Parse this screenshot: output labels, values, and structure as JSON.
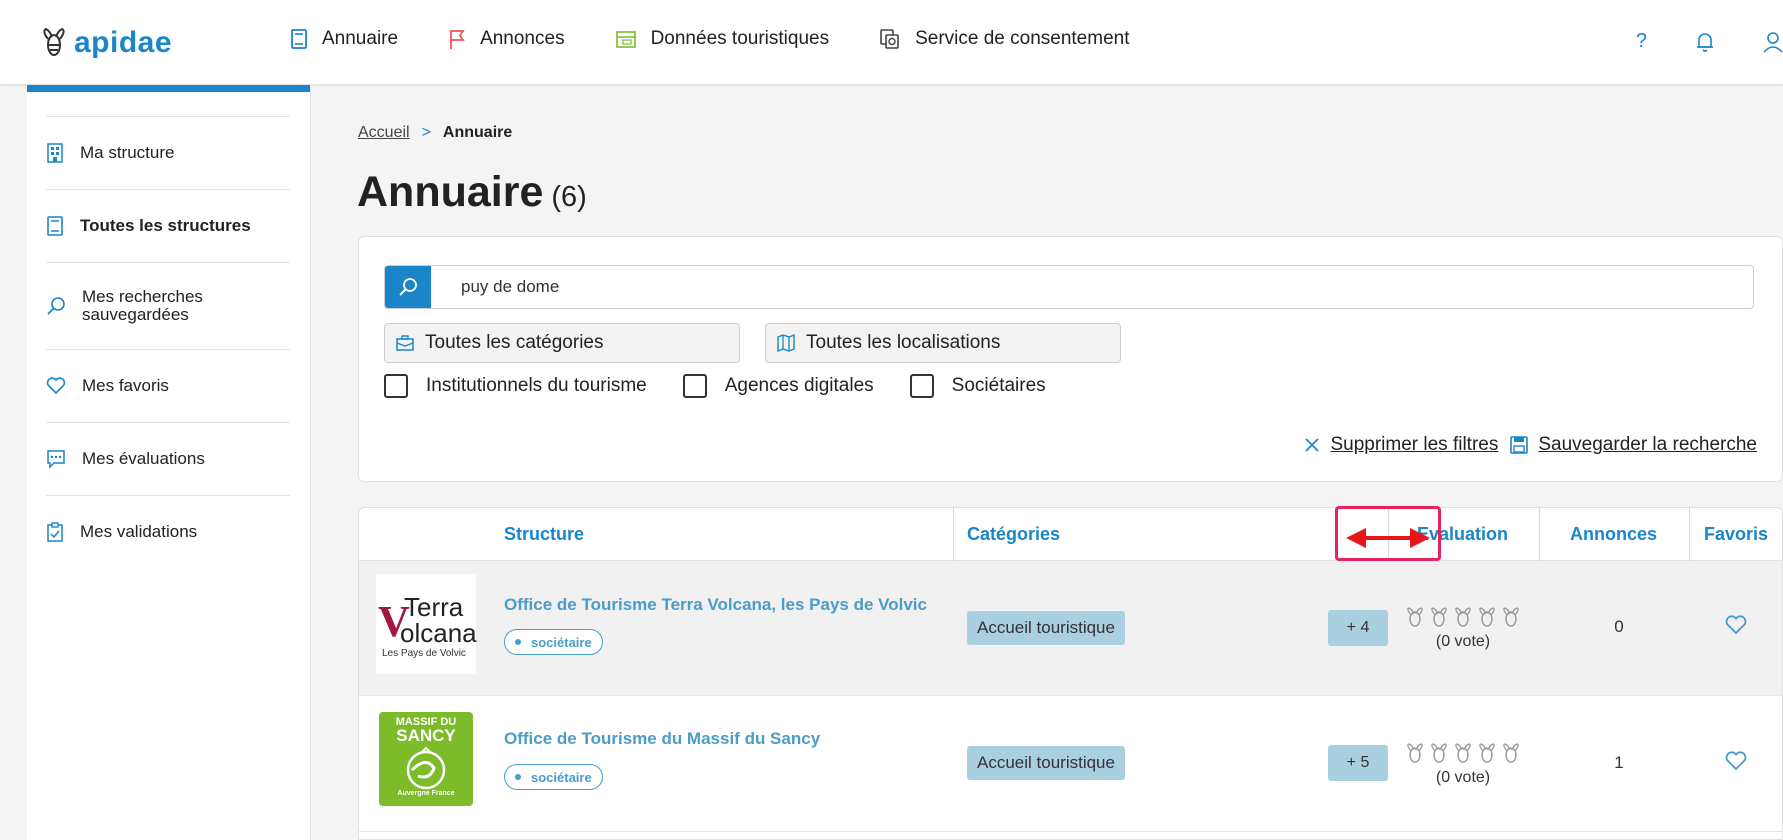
{
  "header": {
    "logo_text": "apidae",
    "nav": [
      {
        "label": "Annuaire",
        "icon": "book-icon"
      },
      {
        "label": "Annonces",
        "icon": "flag-icon"
      },
      {
        "label": "Données touristiques",
        "icon": "database-icon"
      },
      {
        "label": "Service de consentement",
        "icon": "consent-icon"
      }
    ],
    "help_label": "?"
  },
  "sidebar": {
    "items": [
      {
        "label": "Ma structure",
        "icon": "building-icon"
      },
      {
        "label": "Toutes les structures",
        "icon": "book-icon"
      },
      {
        "label": "Mes recherches sauvegardées",
        "icon": "search-icon"
      },
      {
        "label": "Mes favoris",
        "icon": "heart-icon"
      },
      {
        "label": "Mes évaluations",
        "icon": "chat-icon"
      },
      {
        "label": "Mes validations",
        "icon": "clipboard-icon"
      }
    ]
  },
  "breadcrumb": {
    "home": "Accueil",
    "separator": ">",
    "current": "Annuaire"
  },
  "page": {
    "title": "Annuaire",
    "count": "(6)"
  },
  "filters": {
    "search_value": "puy de dome",
    "categories_label": "Toutes les catégories",
    "locations_label": "Toutes les localisations",
    "checkboxes": [
      {
        "label": "Institutionnels du tourisme",
        "checked": false
      },
      {
        "label": "Agences digitales",
        "checked": false
      },
      {
        "label": "Sociétaires",
        "checked": false
      }
    ],
    "clear_label": "Supprimer les filtres",
    "save_label": "Sauvegarder la recherche"
  },
  "table": {
    "columns": {
      "structure": "Structure",
      "categories": "Catégories",
      "evaluation": "Evaluation",
      "annonces": "Annonces",
      "favoris": "Favoris"
    },
    "rows": [
      {
        "name": "Office de Tourisme Terra Volcana, les Pays de Volvic",
        "badge": "sociétaire",
        "category": "Accueil touristique",
        "more": "+ 4",
        "votes": "(0 vote)",
        "annonces": "0",
        "logo": {
          "line1": "Terra",
          "line2": "olcana",
          "initial": "V",
          "sub": "Les Pays de Volvic"
        }
      },
      {
        "name": "Office de Tourisme du Massif du Sancy",
        "badge": "sociétaire",
        "category": "Accueil touristique",
        "more": "+ 5",
        "votes": "(0 vote)",
        "annonces": "1",
        "logo": {
          "line1": "MASSIF DU",
          "line2": "SANCY",
          "sub": "Auvergne France"
        }
      }
    ]
  },
  "colors": {
    "accent": "#1a85c8",
    "pill": "#a9cfe0",
    "link": "#4a9cc9",
    "highlight": "#e4245a",
    "sancy_green": "#7dbb2a"
  }
}
